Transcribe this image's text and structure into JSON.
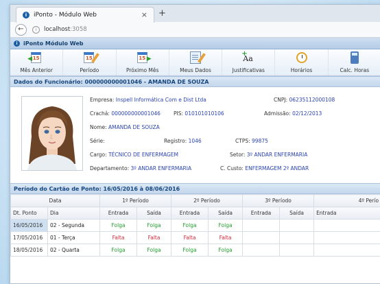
{
  "browser": {
    "tab_title": "iPonto - Módulo Web",
    "tab_close": "×",
    "new_tab": "+",
    "back": "←",
    "info": "i",
    "url_host": "localhost",
    "url_port": ":3058"
  },
  "app": {
    "title": "iPonto Módulo Web",
    "logo": "i"
  },
  "toolbar": {
    "items": [
      {
        "label": "Mês Anterior",
        "icon": "calendar-prev-icon",
        "day": "15"
      },
      {
        "label": "Período",
        "icon": "calendar-edit-icon",
        "day": "15"
      },
      {
        "label": "Próximo Mês",
        "icon": "calendar-next-icon",
        "day": "15"
      },
      {
        "label": "Meus Dados",
        "icon": "document-edit-icon"
      },
      {
        "label": "Justificativas",
        "icon": "add-text-icon",
        "glyph": "Aa"
      },
      {
        "label": "Horários",
        "icon": "clock-icon"
      },
      {
        "label": "Calc. Horas",
        "icon": "calculator-icon"
      }
    ]
  },
  "employee": {
    "header": "Dados do Funcionário: 000000000001046 - AMANDA DE SOUZA",
    "empresa_label": "Empresa:",
    "empresa": "Inspell Informática Com e Dist Ltda",
    "cnpj_label": "CNPJ:",
    "cnpj": "06235112000108",
    "cracha_label": "Crachá:",
    "cracha": "000000000001046",
    "pis_label": "PIS:",
    "pis": "010101010106",
    "admissao_label": "Admissão:",
    "admissao": "02/12/2013",
    "nome_label": "Nome:",
    "nome": "AMANDA DE SOUZA",
    "serie_label": "Série:",
    "serie": "",
    "registro_label": "Registro:",
    "registro": "1046",
    "ctps_label": "CTPS:",
    "ctps": "99875",
    "cargo_label": "Cargo:",
    "cargo": "TÉCNICO DE ENFERMAGEM",
    "setor_label": "Setor:",
    "setor": "3º ANDAR ENFERMARIA",
    "departamento_label": "Departamento:",
    "departamento": "3º ANDAR ENFERMARIA",
    "custo_label": "C. Custo:",
    "custo": "ENFERMAGEM 2º ANDAR"
  },
  "period": {
    "header": "Período do Cartão de Ponto: 16/05/2016 à 08/06/2016",
    "group_headers": [
      "Data",
      "1º Período",
      "2º Período",
      "3º Período",
      "4º Perío"
    ],
    "columns": [
      "Dt. Ponto",
      "Dia",
      "Entrada",
      "Saída",
      "Entrada",
      "Saída",
      "Entrada",
      "Saída",
      "Entrada"
    ],
    "rows": [
      {
        "date": "16/05/2016",
        "day": "02 - Segunda",
        "v": [
          "Folga",
          "Folga",
          "Folga",
          "Folga"
        ],
        "status": "folga"
      },
      {
        "date": "17/05/2016",
        "day": "01 - Terça",
        "v": [
          "Falta",
          "Falta",
          "Falta",
          "Falta"
        ],
        "status": "falta"
      },
      {
        "date": "18/05/2016",
        "day": "02 - Quarta",
        "v": [
          "Folga",
          "Folga",
          "Folga",
          "Folga"
        ],
        "status": "folga"
      }
    ]
  }
}
